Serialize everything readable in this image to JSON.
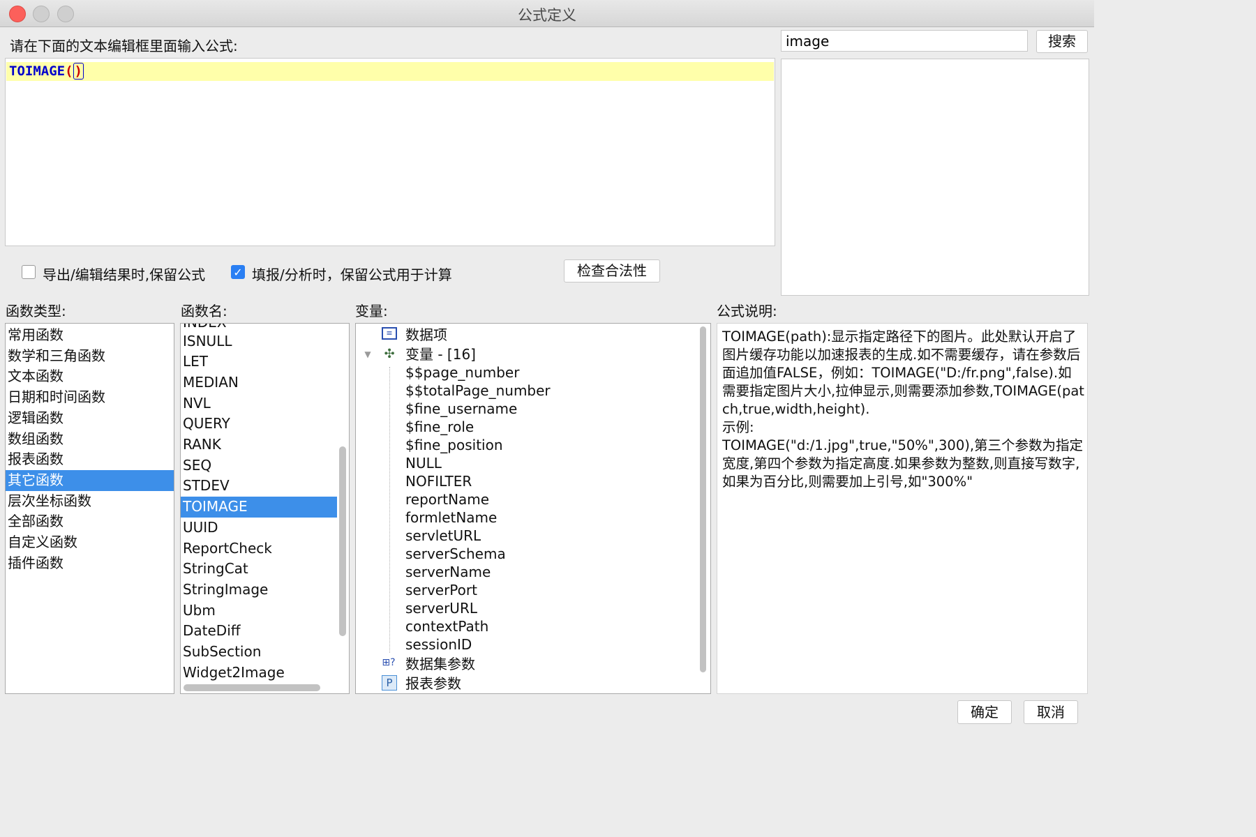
{
  "window": {
    "title": "公式定义"
  },
  "editor": {
    "prompt": "请在下面的文本编辑框里面输入公式:",
    "formula_fn": "TOIMAGE",
    "formula_open": "(",
    "formula_close": ")"
  },
  "search": {
    "value": "image",
    "button": "搜索"
  },
  "options": {
    "keep_formula_label": "导出/编辑结果时,保留公式",
    "keep_formula_checked": false,
    "calc_formula_label": "填报/分析时，保留公式用于计算",
    "calc_formula_checked": true,
    "check_button": "检查合法性"
  },
  "function_types": {
    "header": "函数类型:",
    "items": [
      "常用函数",
      "数学和三角函数",
      "文本函数",
      "日期和时间函数",
      "逻辑函数",
      "数组函数",
      "报表函数",
      "其它函数",
      "层次坐标函数",
      "全部函数",
      "自定义函数",
      "插件函数"
    ],
    "selected": "其它函数"
  },
  "function_names": {
    "header": "函数名:",
    "partial_top": "INDEX",
    "items": [
      "ISNULL",
      "LET",
      "MEDIAN",
      "NVL",
      "QUERY",
      "RANK",
      "SEQ",
      "STDEV",
      "TOIMAGE",
      "UUID",
      "ReportCheck",
      "StringCat",
      "StringImage",
      "Ubm",
      "DateDiff",
      "SubSection",
      "Widget2Image"
    ],
    "selected": "TOIMAGE"
  },
  "variables": {
    "header": "变量:",
    "data_items": "数据项",
    "variables_node": "变量 - [16]",
    "children": [
      "$$page_number",
      "$$totalPage_number",
      "$fine_username",
      "$fine_role",
      "$fine_position",
      "NULL",
      "NOFILTER",
      "reportName",
      "formletName",
      "servletURL",
      "serverSchema",
      "serverName",
      "serverPort",
      "serverURL",
      "contextPath",
      "sessionID"
    ],
    "dataset_params": "数据集参数",
    "report_params": "报表参数",
    "icons": [
      "list-icon",
      "variable-icon",
      "dataset-param-icon",
      "param-p-icon"
    ]
  },
  "description": {
    "header": "公式说明:",
    "text": "TOIMAGE(path):显示指定路径下的图片。此处默认开启了图片缓存功能以加速报表的生成.如不需要缓存，请在参数后面追加值FALSE，例如：TOIMAGE(\"D:/fr.png\",false).如需要指定图片大小,拉伸显示,则需要添加参数,TOIMAGE(patch,true,width,height).\n示例:\nTOIMAGE(\"d:/1.jpg\",true,\"50%\",300),第三个参数为指定宽度,第四个参数为指定高度.如果参数为整数,则直接写数字,如果为百分比,则需要加上引号,如\"300%\""
  },
  "footer": {
    "ok": "确定",
    "cancel": "取消"
  }
}
